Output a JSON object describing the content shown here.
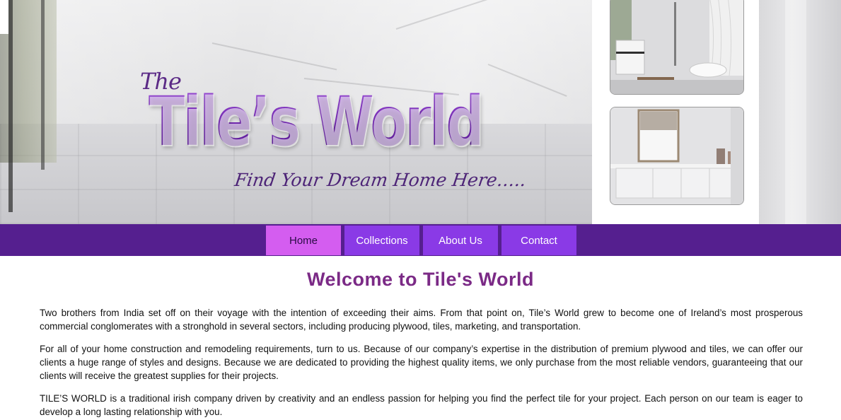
{
  "hero": {
    "logo_prefix": "The",
    "logo_title": "Tile’s World",
    "tagline": "Find Your Dream Home Here….."
  },
  "nav": {
    "items": [
      {
        "label": "Home",
        "active": true
      },
      {
        "label": "Collections",
        "active": false
      },
      {
        "label": "About Us",
        "active": false
      },
      {
        "label": "Contact",
        "active": false
      }
    ]
  },
  "content": {
    "heading": "Welcome to Tile's World",
    "paragraphs": [
      "Two brothers from India set off on their voyage with the intention of exceeding their aims. From that point on, Tile’s World grew to become one of Ireland’s most prosperous commercial conglomerates with a stronghold in several sectors, including producing plywood, tiles, marketing, and transportation.",
      "For all of your home construction and remodeling requirements, turn to us. Because of our company’s expertise in the distribution of premium plywood and tiles, we can offer our clients a huge range of styles and designs. Because we are dedicated to providing the highest quality items, we only purchase from the most reliable vendors, guaranteeing that our clients will receive the greatest supplies for their projects.",
      "TILE’S WORLD is a traditional irish company driven by creativity and an endless passion for helping you find the perfect tile for your project. Each person on our team is eager to develop a long lasting relationship with you."
    ]
  },
  "colors": {
    "nav_bar": "#551f8f",
    "nav_item": "#8a3ae6",
    "nav_item_active": "#d45df0",
    "heading": "#7b2a86",
    "logo": "#7a2fb9"
  }
}
